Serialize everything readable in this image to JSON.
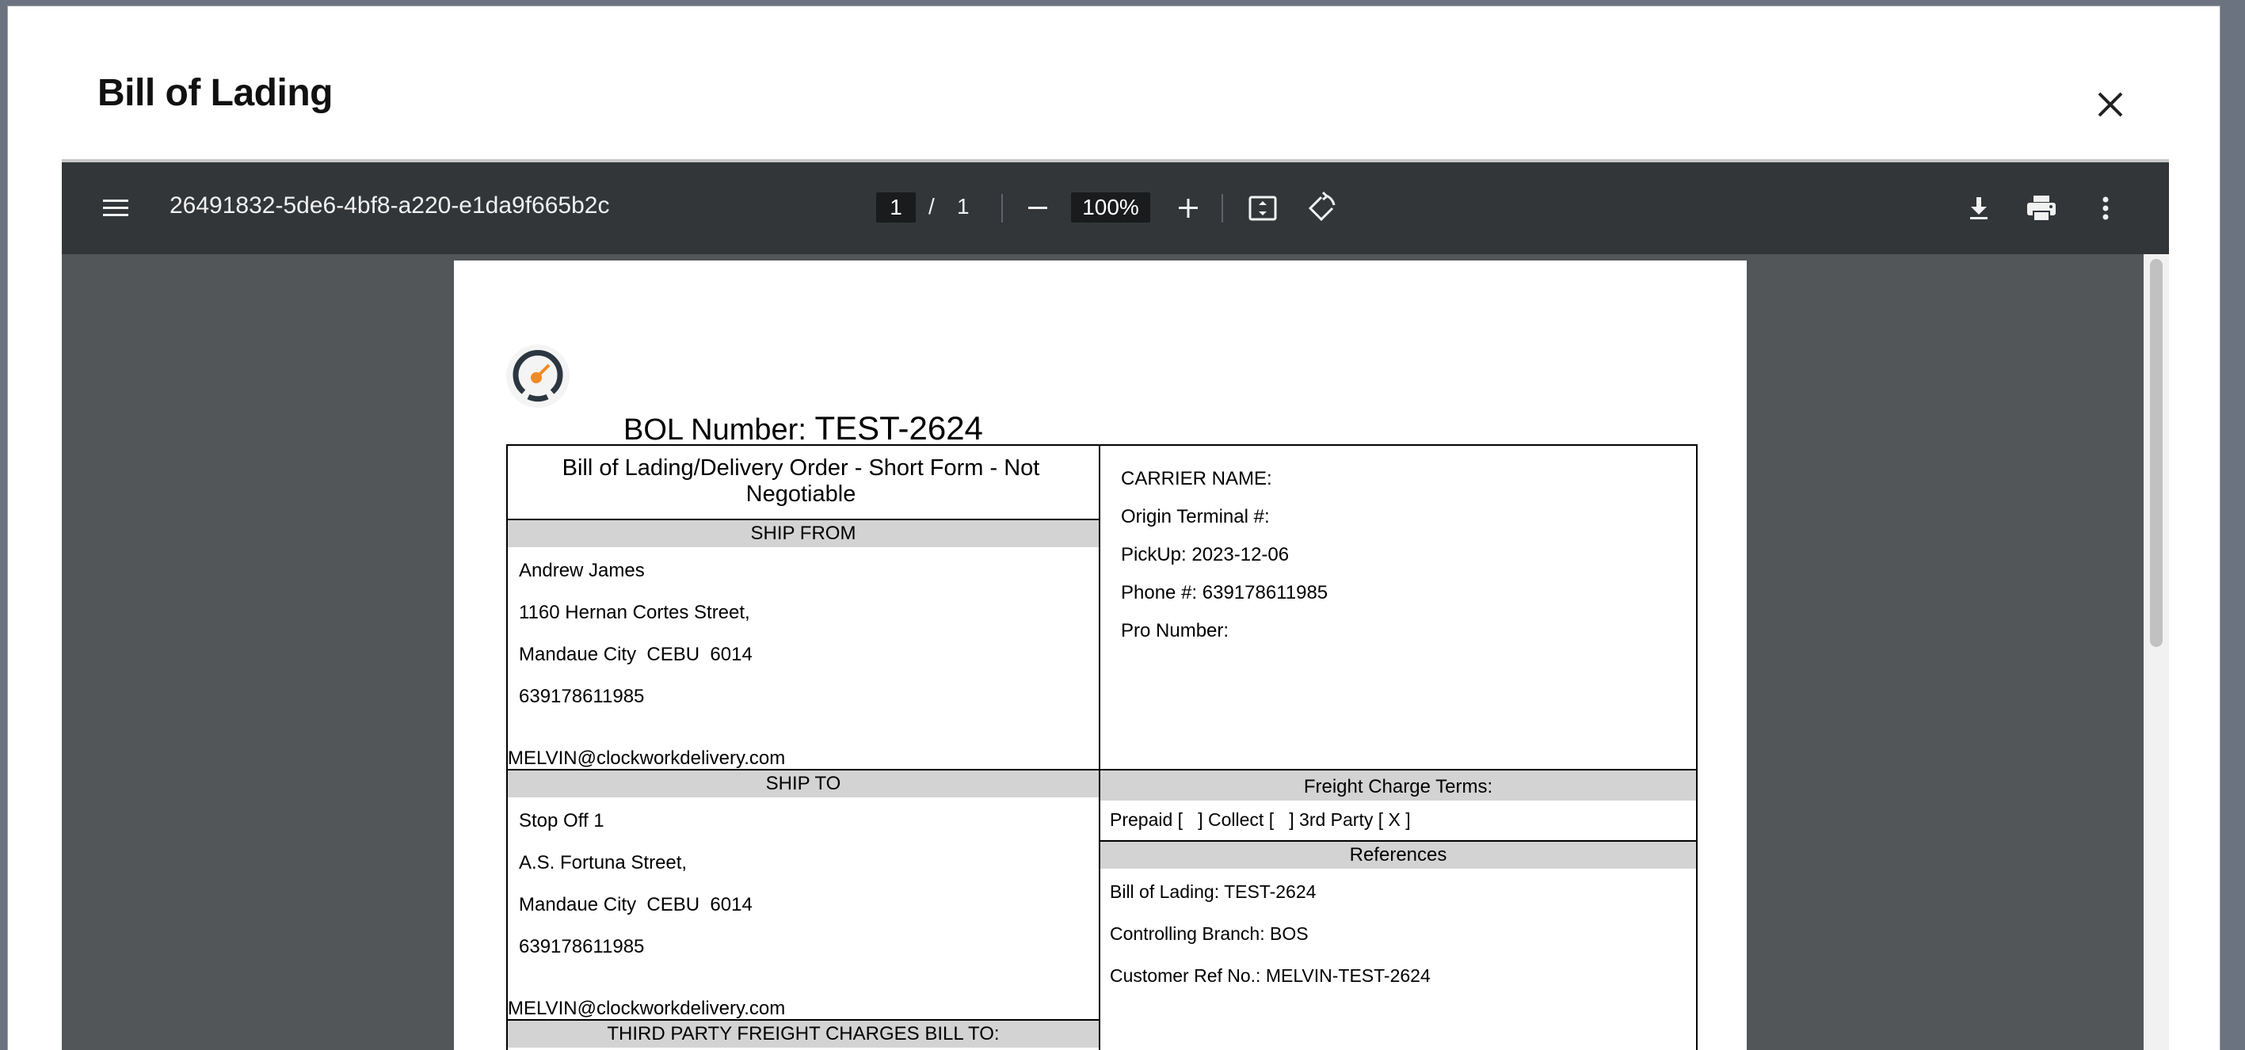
{
  "modal": {
    "title": "Bill of Lading",
    "close_icon": "close-icon"
  },
  "viewer": {
    "file_name": "26491832-5de6-4bf8-a220-e1da9f665b2c",
    "page_current": "1",
    "page_separator": "/",
    "page_total": "1",
    "zoom": "100%",
    "icons": [
      "menu-icon",
      "zoom-out-icon",
      "zoom-in-icon",
      "fit-page-icon",
      "rotate-icon",
      "download-icon",
      "print-icon",
      "more-options-icon"
    ]
  },
  "document": {
    "bol_label": "BOL Number:",
    "bol_number": "TEST-2624",
    "form_title": "Bill of Lading/Delivery Order - Short Form - Not Negotiable",
    "ship_from": {
      "heading": "SHIP FROM",
      "name": "Andrew James",
      "street": "1160 Hernan Cortes Street,",
      "city_line": "Mandaue City  CEBU  6014",
      "phone": "639178611985",
      "email": "MELVIN@clockworkdelivery.com"
    },
    "carrier": {
      "carrier_name": "CARRIER NAME:",
      "origin_terminal": "Origin Terminal #:",
      "pickup": "PickUp: 2023-12-06",
      "phone": "Phone #: 639178611985",
      "pro_number": "Pro Number:"
    },
    "ship_to": {
      "heading": "SHIP TO",
      "name": "Stop Off 1",
      "street": "A.S. Fortuna Street,",
      "city_line": "Mandaue City  CEBU  6014",
      "phone": "639178611985",
      "email": "MELVIN@clockworkdelivery.com"
    },
    "freight": {
      "heading": "Freight Charge Terms:",
      "terms": "Prepaid [   ] Collect [   ] 3rd Party [ X ]"
    },
    "references": {
      "heading": "References",
      "bill_of_lading": "Bill of Lading: TEST-2624",
      "controlling_branch": "Controlling Branch: BOS",
      "customer_ref": "Customer Ref No.: MELVIN-TEST-2624"
    },
    "third_party": {
      "heading": "THIRD PARTY FREIGHT CHARGES BILL TO:"
    }
  }
}
